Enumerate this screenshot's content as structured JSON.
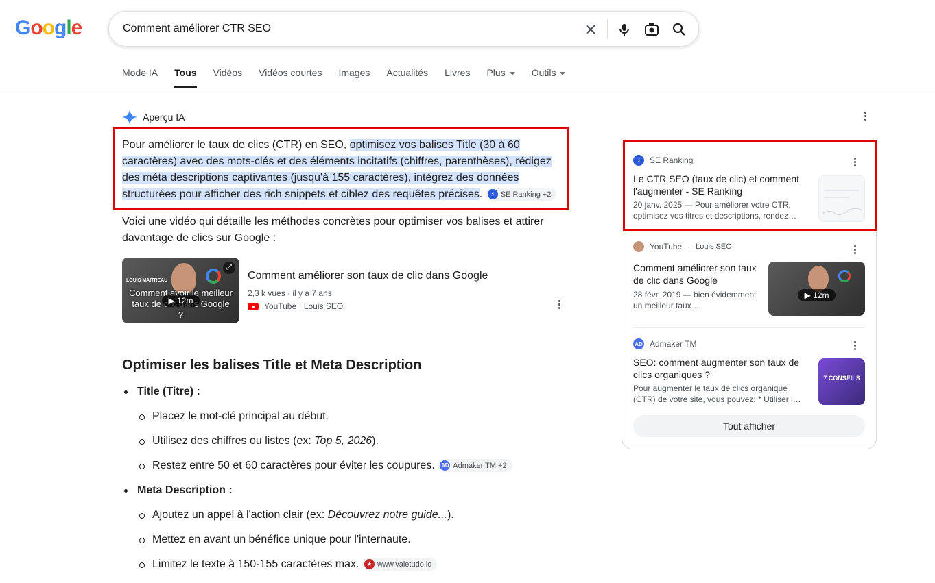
{
  "logo": "Google",
  "search": {
    "query": "Comment améliorer CTR SEO"
  },
  "tabs": [
    "Mode IA",
    "Tous",
    "Vidéos",
    "Vidéos courtes",
    "Images",
    "Actualités",
    "Livres",
    "Plus",
    "Outils"
  ],
  "ai_overview": {
    "label": "Aperçu IA",
    "para_start": "Pour améliorer le taux de clics (CTR) en SEO, ",
    "para_highlight": "optimisez vos balises Title (30 à 60 caractères) avec des mots-clés et des éléments incitatifs (chiffres, parenthèses), rédigez des méta descriptions captivantes (jusqu'à 155 caractères), intégrez des données structurées pour afficher des rich snippets et ciblez des requêtes précises",
    "para_end": ".",
    "chip1": "SE Ranking +2",
    "para2": "Voici une vidéo qui détaille les méthodes concrètes pour optimiser vos balises et attirer davantage de clics sur Google :",
    "video": {
      "title": "Comment améliorer son taux de clic dans Google",
      "meta": "2,3 k vues · il y a 7 ans",
      "source": "YouTube · Louis SEO",
      "duration": "12m",
      "thumb_text": "Comment avoir le meilleur taux de clic dans Google ?",
      "thumb_brand": "LOUIS MAÎTREAU"
    },
    "section_title": "Optimiser les balises Title et Meta Description",
    "title_item": "Title (Titre) :",
    "title_sub1": "Placez le mot-clé principal au début.",
    "title_sub2_a": "Utilisez des chiffres ou listes (ex: ",
    "title_sub2_em": "Top 5, 2026",
    "title_sub2_b": ").",
    "title_sub3": "Restez entre 50 et 60 caractères pour éviter les coupures.",
    "chip2": "Admaker TM +2",
    "meta_item": "Meta Description :",
    "meta_sub1_a": "Ajoutez un appel à l'action clair (ex: ",
    "meta_sub1_em": "Découvrez notre guide...",
    "meta_sub1_b": ").",
    "meta_sub2": "Mettez en avant un bénéfice unique pour l'internaute.",
    "meta_sub3": "Limitez le texte à 150-155 caractères max.",
    "chip3": "www.valetudo.io"
  },
  "sidebar": {
    "cards": [
      {
        "source": "SE Ranking",
        "title": "Le CTR SEO (taux de clic) et comment l'augmenter - SE Ranking",
        "desc": "20 janv. 2025 — Pour améliorer votre CTR, optimisez vos titres et descriptions, rendez…"
      },
      {
        "source": "YouTube",
        "source_extra": "Louis SEO",
        "title": "Comment améliorer son taux de clic dans Google",
        "desc": "28 févr. 2019 — bien évidemment un meilleur taux …",
        "duration": "12m"
      },
      {
        "source": "Admaker TM",
        "title": "SEO: comment augmenter son taux de clics organiques ?",
        "desc": "Pour augmenter le taux de clics organique (CTR) de votre site, vous pouvez: * Utiliser l…",
        "thumb_text": "7 CONSEILS"
      }
    ],
    "show_all": "Tout afficher"
  },
  "colors": {
    "highlight": "#d3e3fd",
    "red_box": "#e00000",
    "link_blue": "#1a0dab"
  }
}
